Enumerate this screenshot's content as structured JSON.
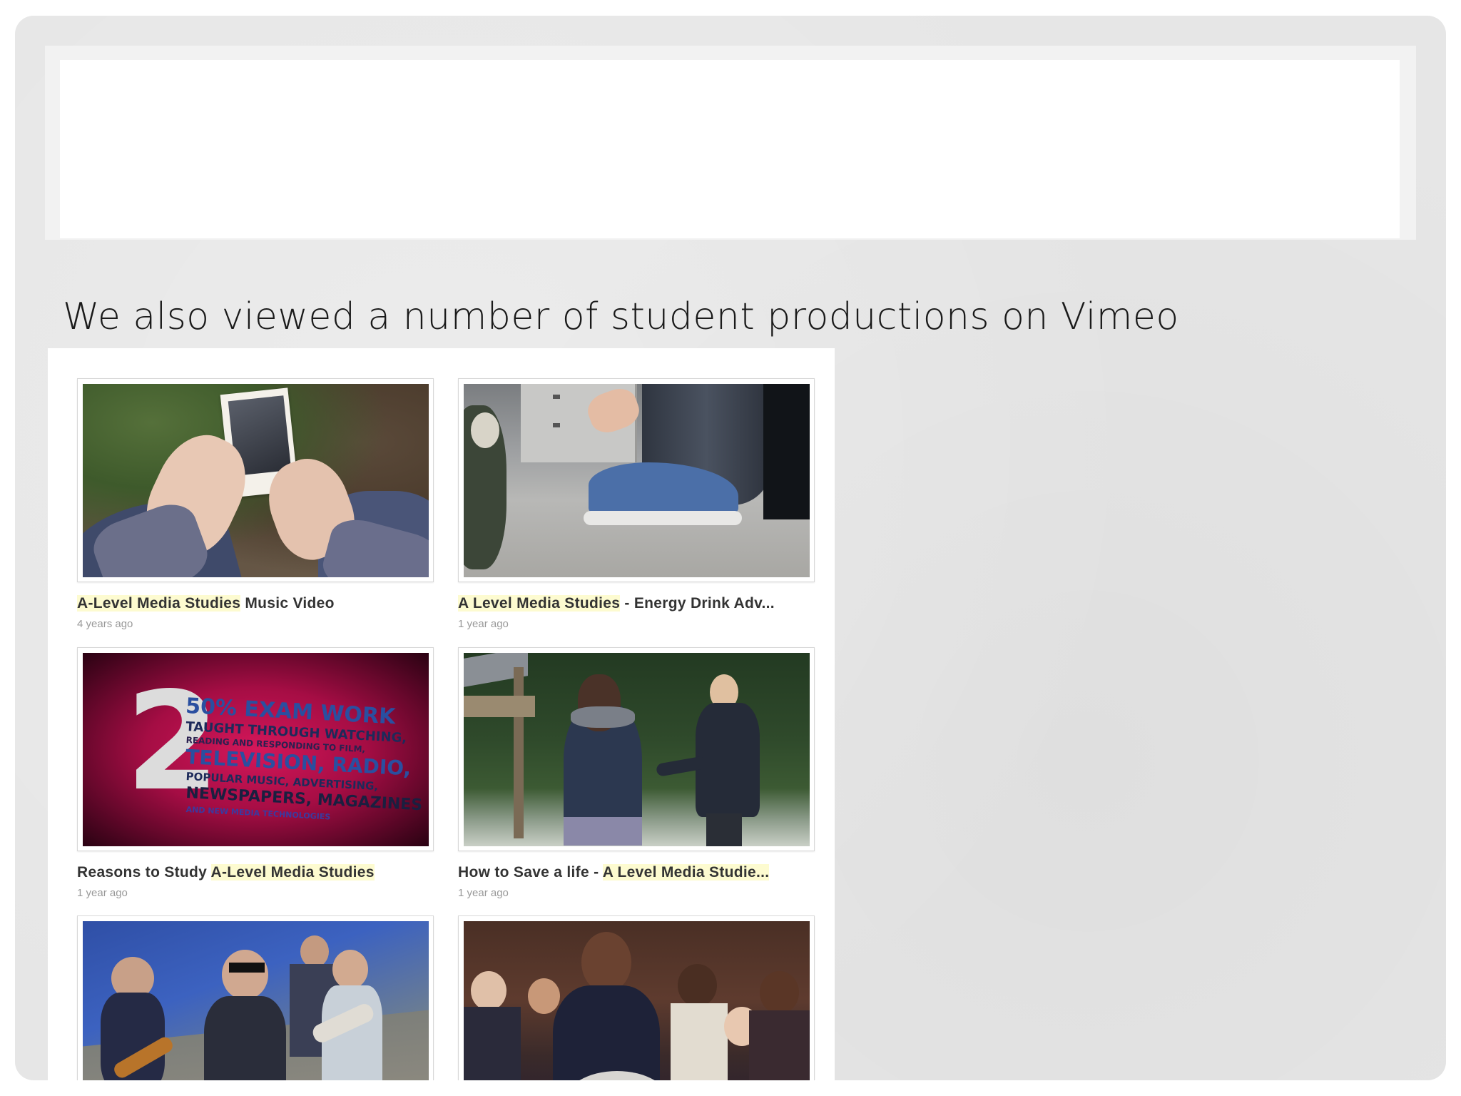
{
  "slide": {
    "body_text": "We also viewed a number of student productions on Vimeo"
  },
  "videos": [
    {
      "title_highlight": "A-Level Media Studies",
      "title_rest": " Music Video",
      "date": "4 years ago"
    },
    {
      "title_highlight": "A Level Media Studies",
      "title_rest": " - Energy Drink Adv...",
      "date": "1 year ago"
    },
    {
      "title_prefix": "Reasons to Study ",
      "title_highlight": "A-Level Media Studies",
      "date": "1 year ago",
      "thumb_text": {
        "number": "2",
        "lines": [
          "50% EXAM WORK",
          "TAUGHT THROUGH WATCHING,",
          "READING AND RESPONDING TO FILM,",
          "TELEVISION, RADIO,",
          "POPULAR MUSIC, ADVERTISING,",
          "NEWSPAPERS, MAGAZINES",
          "AND NEW MEDIA TECHNOLOGIES"
        ]
      }
    },
    {
      "title_prefix": "How to Save a life - ",
      "title_highlight": "A Level Media Studie...",
      "date": "1 year ago"
    }
  ],
  "colors": {
    "slide_bg": "#e6e6e6",
    "highlight": "#fdfbd0",
    "date_gray": "#999999",
    "thumb_red": "#a50d44",
    "thumb_text_blue": "#2a4fa0"
  }
}
